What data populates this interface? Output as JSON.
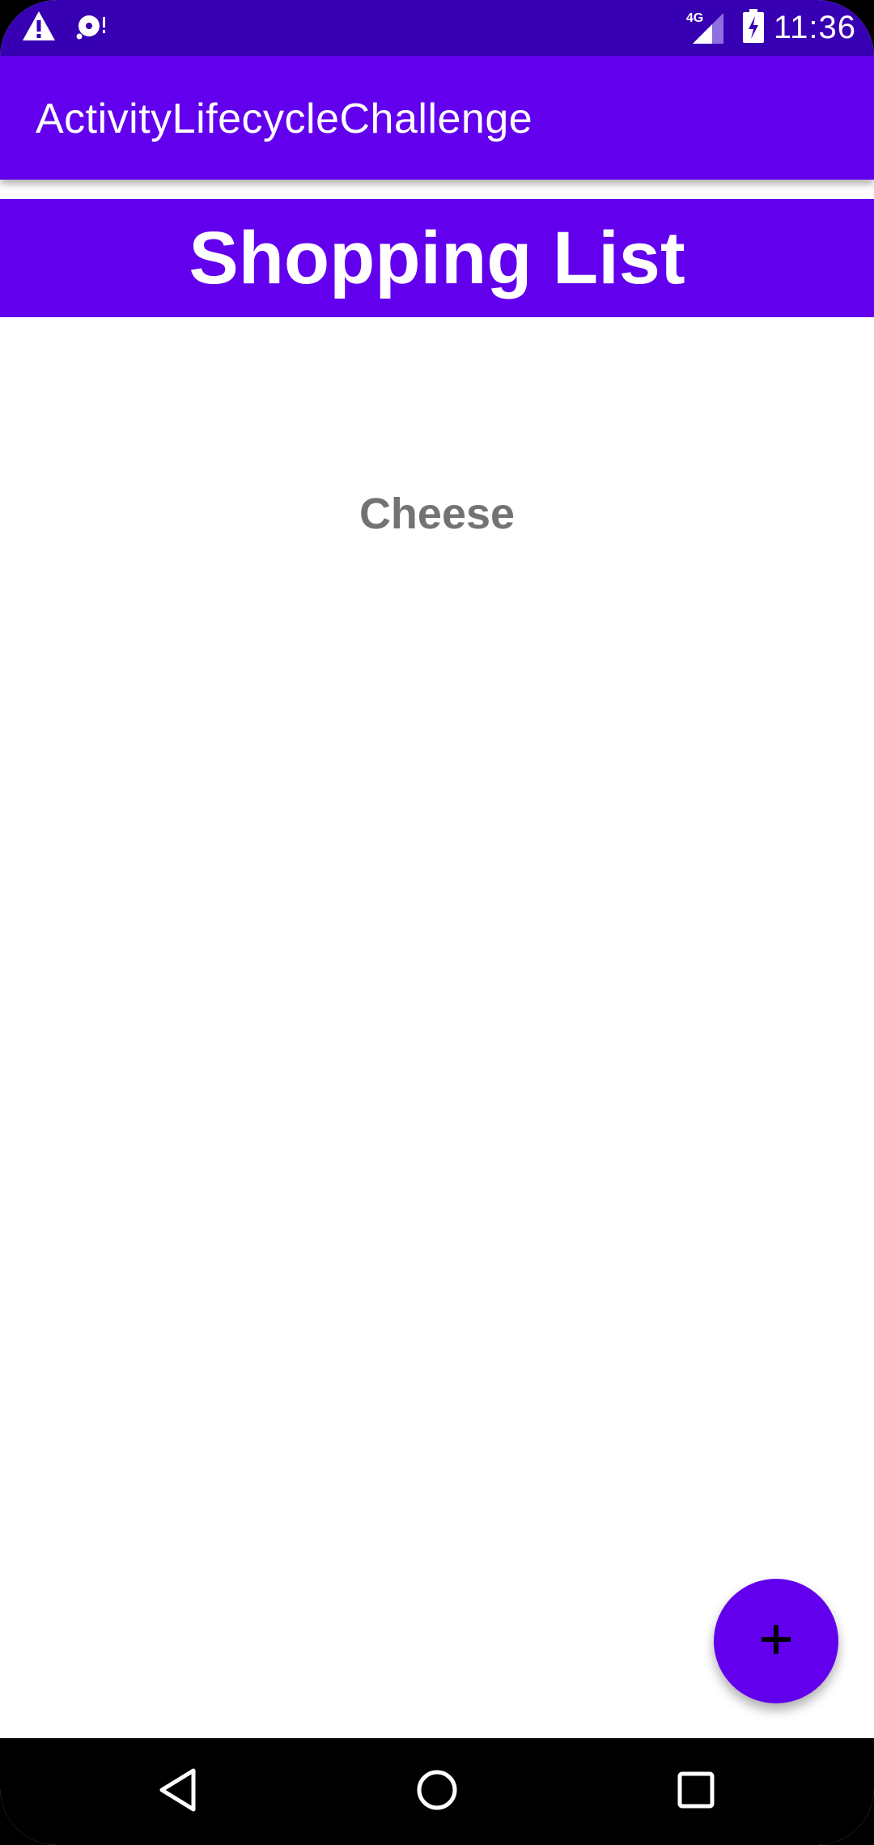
{
  "status_bar": {
    "time": "11:36",
    "network_type": "4G",
    "icons": [
      "warning-icon",
      "media-sync-icon",
      "signal-icon",
      "battery-charging-icon"
    ]
  },
  "app_bar": {
    "title": "ActivityLifecycleChallenge"
  },
  "list": {
    "header": "Shopping List",
    "items": [
      "Cheese"
    ]
  },
  "fab": {
    "icon": "add-icon"
  },
  "navigation": {
    "buttons": [
      "back-icon",
      "home-icon",
      "recents-icon"
    ]
  },
  "colors": {
    "primary": "#6200ee",
    "primary_dark": "#3700b3",
    "item_text": "#737373"
  }
}
